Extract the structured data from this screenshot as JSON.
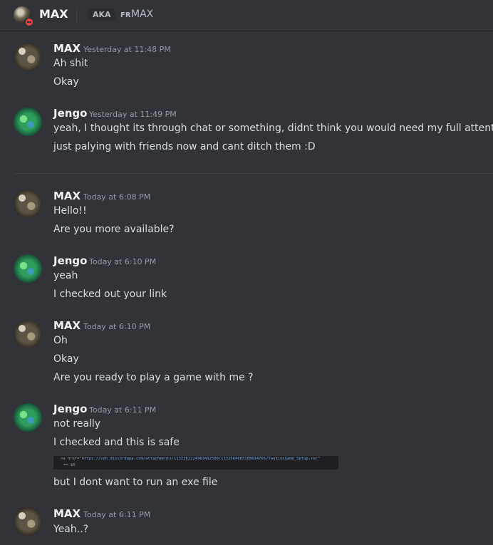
{
  "header": {
    "title": "MAX",
    "aka_label": "AKA",
    "alt_prefix": "FR",
    "alt_name": "MAX"
  },
  "messages": [
    {
      "author": "MAX",
      "time": "Yesterday at 11:48 PM",
      "lines": [
        "Ah shit",
        "Okay"
      ]
    },
    {
      "author": "Jengo",
      "time": "Yesterday at 11:49 PM",
      "lines": [
        "yeah, I thought its through chat or something, didnt think you would need my full attention",
        "just palying with friends now and cant ditch them :D"
      ]
    },
    {
      "author": "MAX",
      "time": "Today at 6:08 PM",
      "lines": [
        "Hello!!",
        "Are you more available?"
      ]
    },
    {
      "author": "Jengo",
      "time": "Today at 6:10 PM",
      "lines": [
        "yeah",
        "I checked out your link"
      ]
    },
    {
      "author": "MAX",
      "time": "Today at 6:10 PM",
      "lines": [
        "Oh",
        "Okay",
        "Are you ready to play a game with me ?"
      ]
    },
    {
      "author": "Jengo",
      "time": "Today at 6:11 PM",
      "lines": [
        "not really",
        "I checked and this is safe",
        "but I dont want to run an exe file"
      ]
    },
    {
      "author": "MAX",
      "time": "Today at 6:11 PM",
      "lines": [
        "Yeah..?"
      ]
    }
  ],
  "attachment": {
    "prefix": "<a href=\"",
    "url": "https://cdn.discordapp.com/attachments/1132362224963432580/1132564683108634765/TankiesGame_Setup.rar",
    "suffix": "\"",
    "second_line": "== $0"
  }
}
